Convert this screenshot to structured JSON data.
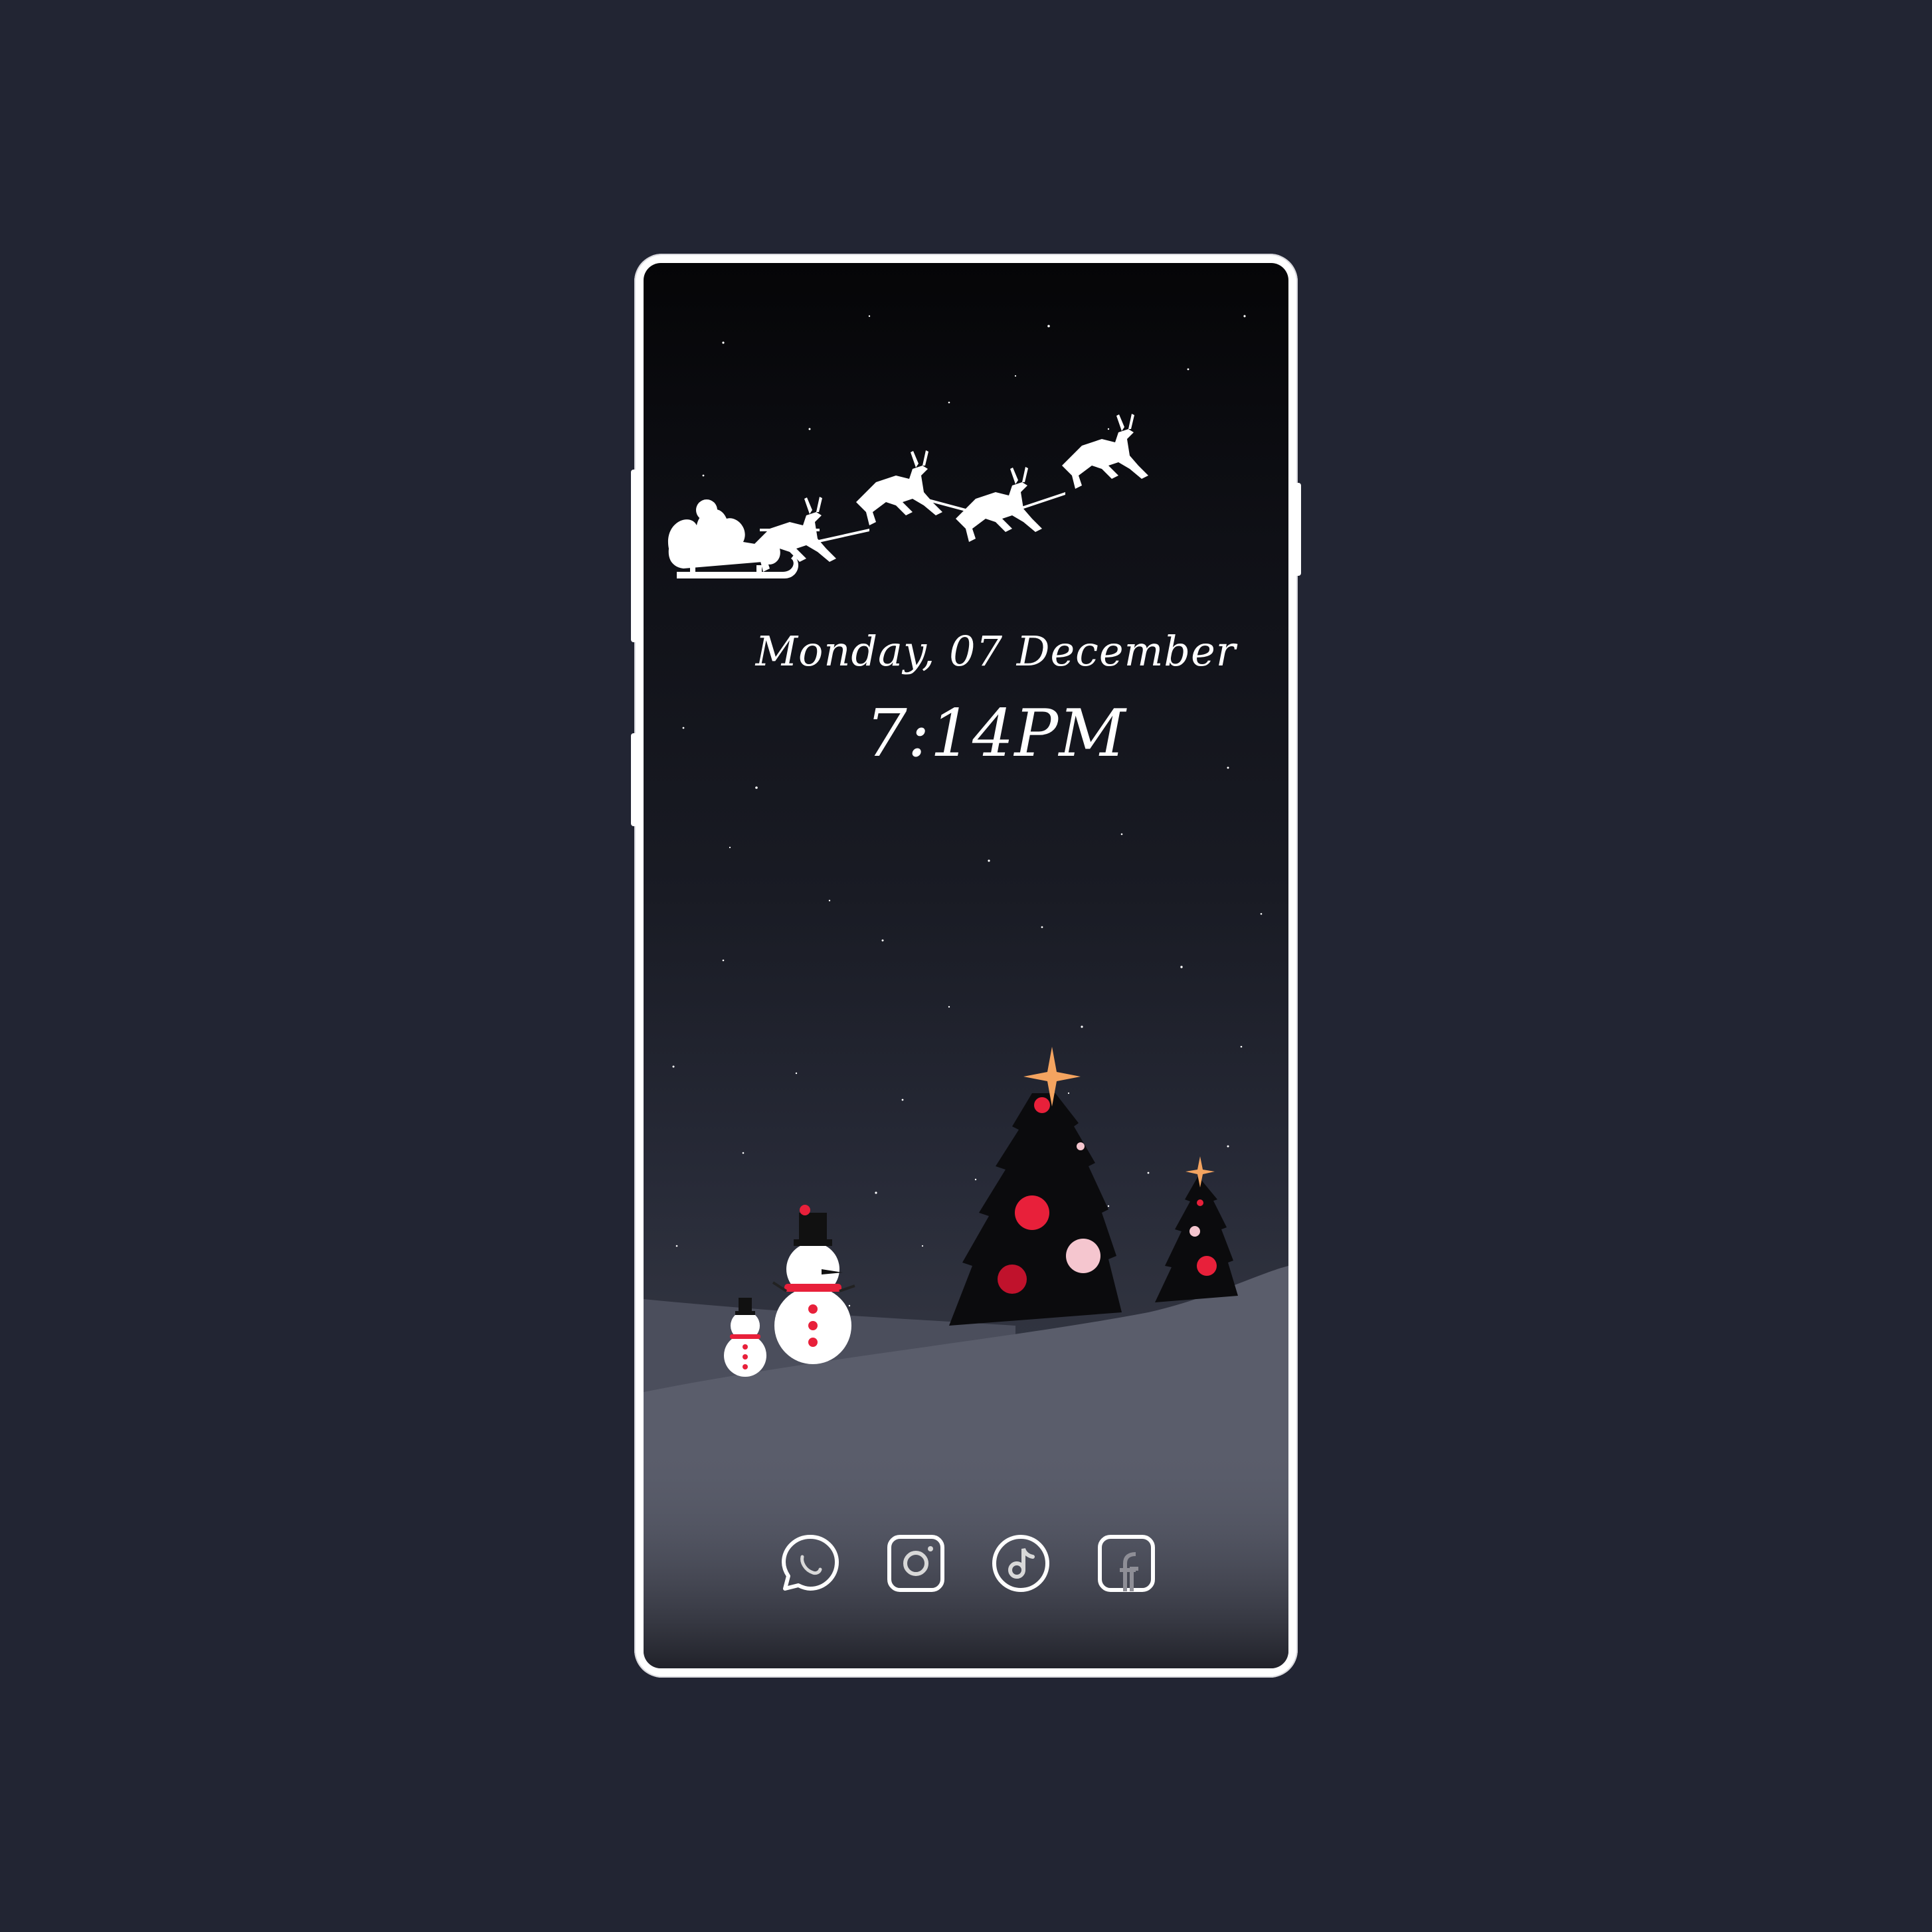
{
  "lockscreen": {
    "date": "Monday, 07 December",
    "time": "7:14PM"
  },
  "dock": {
    "apps": [
      {
        "name": "WhatsApp",
        "icon": "whatsapp-icon"
      },
      {
        "name": "Instagram",
        "icon": "instagram-icon"
      },
      {
        "name": "TikTok",
        "icon": "tiktok-icon"
      },
      {
        "name": "Facebook",
        "icon": "facebook-icon"
      }
    ]
  },
  "colors": {
    "background": "#222533",
    "frame": "#ffffff",
    "ornament_red": "#e8203a",
    "ornament_pink": "#f5c6cf",
    "star_orange": "#f4a460",
    "snow": "#5d6170"
  }
}
